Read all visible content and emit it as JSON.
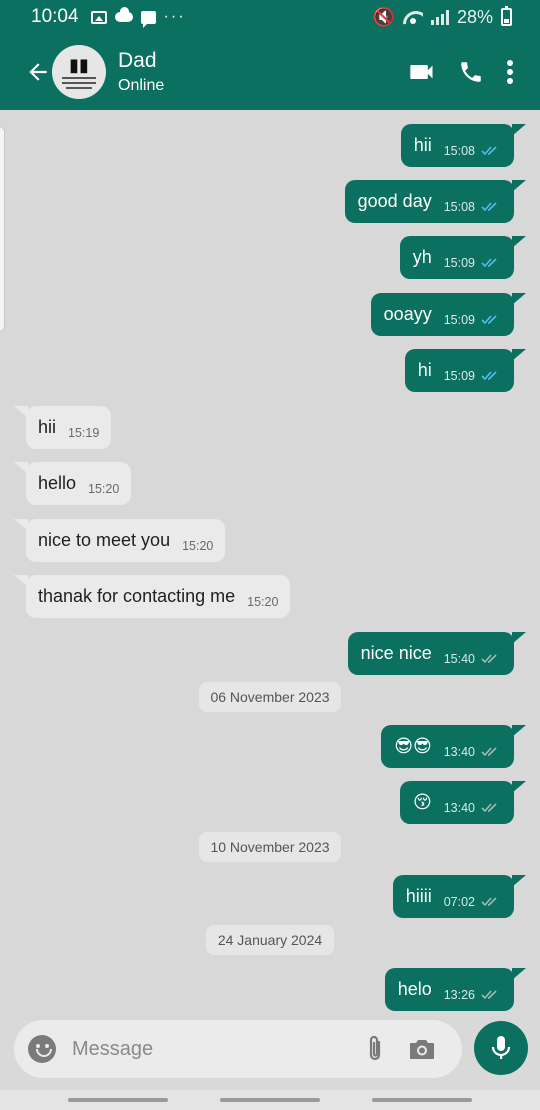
{
  "status_bar": {
    "time": "10:04",
    "more": "···",
    "mute_icon": "🔇",
    "battery": "28%"
  },
  "header": {
    "back_icon": "arrow-left-icon",
    "contact_name": "Dad",
    "contact_status": "Online",
    "actions": [
      "video-call-icon",
      "voice-call-icon",
      "more-options-icon"
    ]
  },
  "messages": [
    {
      "dir": "out",
      "text": "hii",
      "time": "15:08",
      "read": true
    },
    {
      "dir": "out",
      "text": "good day",
      "time": "15:08",
      "read": true
    },
    {
      "dir": "out",
      "text": "yh",
      "time": "15:09",
      "read": true
    },
    {
      "dir": "out",
      "text": "ooayy",
      "time": "15:09",
      "read": true
    },
    {
      "dir": "out",
      "text": "hi",
      "time": "15:09",
      "read": true
    },
    {
      "dir": "in",
      "text": "hii",
      "time": "15:19"
    },
    {
      "dir": "in",
      "text": "hello",
      "time": "15:20"
    },
    {
      "dir": "in",
      "text": "nice to meet you",
      "time": "15:20"
    },
    {
      "dir": "in",
      "text": "thanak for contacting me",
      "time": "15:20"
    },
    {
      "dir": "out",
      "text": "nice nice",
      "time": "15:40",
      "read": false
    },
    {
      "type": "date",
      "text": "06 November 2023"
    },
    {
      "dir": "out",
      "text": "😎😎",
      "time": "13:40",
      "read": false
    },
    {
      "dir": "out",
      "text": "😚",
      "time": "13:40",
      "read": false
    },
    {
      "type": "date",
      "text": "10 November 2023"
    },
    {
      "dir": "out",
      "text": "hiiii",
      "time": "07:02",
      "read": false
    },
    {
      "type": "date",
      "text": "24 January 2024"
    },
    {
      "dir": "out",
      "text": "helo",
      "time": "13:26",
      "read": false
    }
  ],
  "input": {
    "placeholder": "Message"
  },
  "colors": {
    "brand": "#0b7060",
    "incoming_bubble": "#eaeaea",
    "read_tick": "#53bdeb",
    "unread_tick": "#9fb9b3",
    "chat_background": "#d8d8d8"
  }
}
